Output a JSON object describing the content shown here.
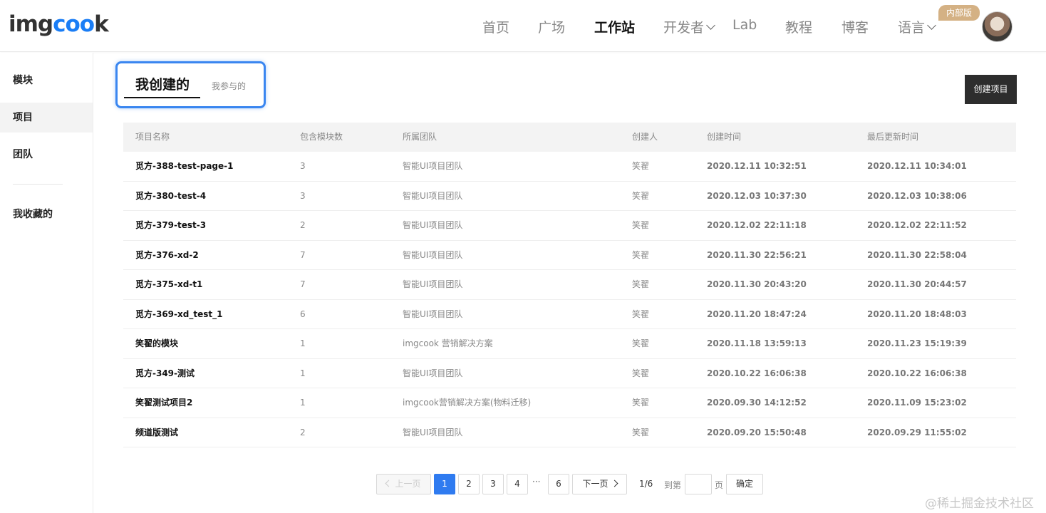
{
  "header": {
    "logo_prefix": "img",
    "logo_oo": "coo",
    "logo_suffix": "k",
    "nav": [
      "首页",
      "广场",
      "工作站",
      "开发者",
      "Lab",
      "教程",
      "博客",
      "语言"
    ],
    "active_nav": "工作站",
    "badge": "内部版"
  },
  "sidebar": {
    "items": [
      "模块",
      "项目",
      "团队",
      "我收藏的"
    ],
    "active": "项目"
  },
  "tabs": {
    "main": "我创建的",
    "sub": "我参与的"
  },
  "toolbar": {
    "create_label": "创建项目"
  },
  "table": {
    "headers": [
      "项目名称",
      "包含模块数",
      "所属团队",
      "创建人",
      "创建时间",
      "最后更新时间"
    ],
    "rows": [
      [
        "觅方-388-test-page-1",
        "3",
        "智能UI项目团队",
        "笑翟",
        "2020.12.11 10:32:51",
        "2020.12.11 10:34:01"
      ],
      [
        "觅方-380-test-4",
        "3",
        "智能UI项目团队",
        "笑翟",
        "2020.12.03 10:37:30",
        "2020.12.03 10:38:06"
      ],
      [
        "觅方-379-test-3",
        "2",
        "智能UI项目团队",
        "笑翟",
        "2020.12.02 22:11:18",
        "2020.12.02 22:11:52"
      ],
      [
        "觅方-376-xd-2",
        "7",
        "智能UI项目团队",
        "笑翟",
        "2020.11.30 22:56:21",
        "2020.11.30 22:58:04"
      ],
      [
        "觅方-375-xd-t1",
        "7",
        "智能UI项目团队",
        "笑翟",
        "2020.11.30 20:43:20",
        "2020.11.30 20:44:57"
      ],
      [
        "觅方-369-xd_test_1",
        "6",
        "智能UI项目团队",
        "笑翟",
        "2020.11.20 18:47:24",
        "2020.11.20 18:48:03"
      ],
      [
        "笑翟的模块",
        "1",
        "imgcook 营销解决方案",
        "笑翟",
        "2020.11.18 13:59:13",
        "2020.11.23 15:19:39"
      ],
      [
        "觅方-349-测试",
        "1",
        "智能UI项目团队",
        "笑翟",
        "2020.10.22 16:06:38",
        "2020.10.22 16:06:38"
      ],
      [
        "笑翟测试项目2",
        "1",
        "imgcook营销解决方案(物料迁移)",
        "笑翟",
        "2020.09.30 14:12:52",
        "2020.11.09 15:23:02"
      ],
      [
        "频道版测试",
        "2",
        "智能UI项目团队",
        "笑翟",
        "2020.09.20 15:50:48",
        "2020.09.29 11:55:02"
      ]
    ]
  },
  "pagination": {
    "prev": "上一页",
    "pages": [
      "1",
      "2",
      "3",
      "4"
    ],
    "ellipsis": "···",
    "last": "6",
    "next": "下一页",
    "current_total": "1/6",
    "goto_prefix": "到第",
    "goto_suffix": "页",
    "confirm": "确定"
  },
  "watermark": "@稀土掘金技术社区",
  "colors": {
    "primary": "#2f7bf0",
    "highlight_border": "#3a86f0",
    "badge": "#d4b184",
    "dark_button": "#2d2d2d"
  }
}
